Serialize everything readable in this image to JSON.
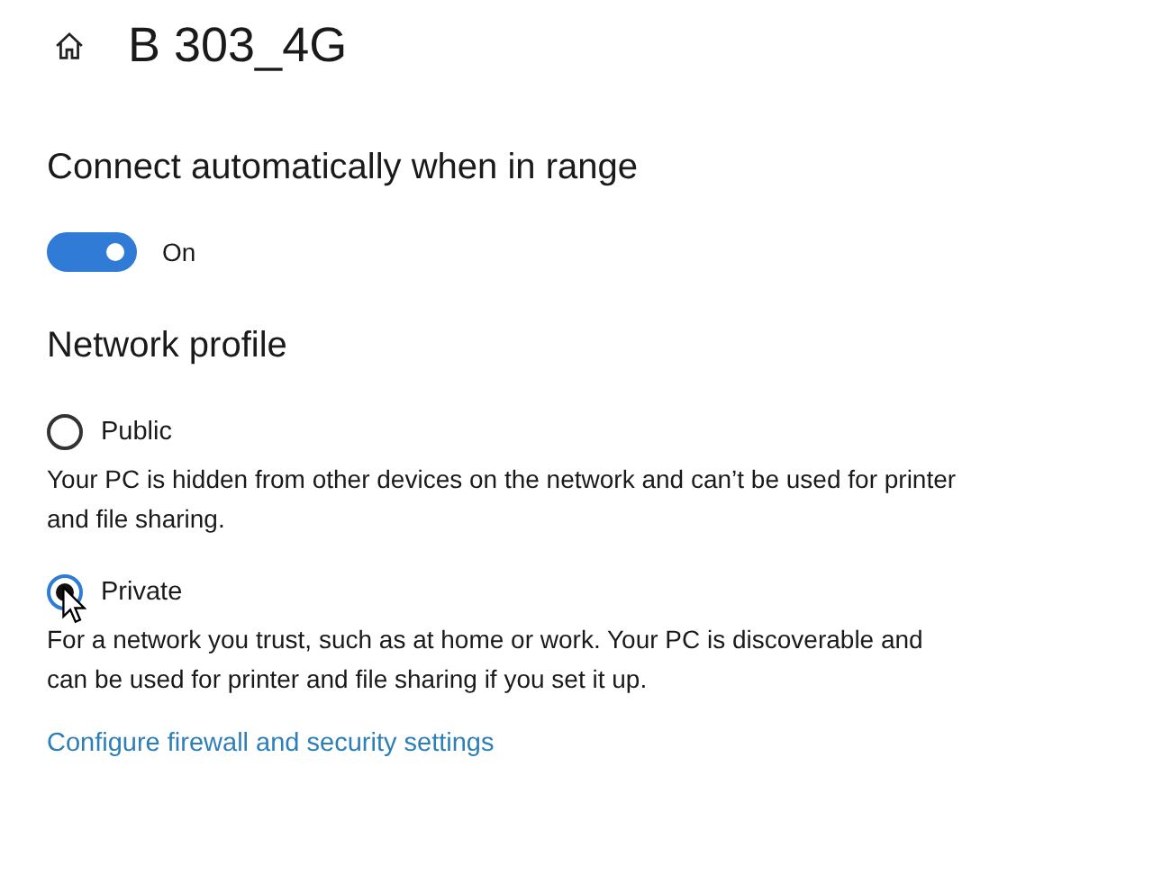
{
  "header": {
    "title": "B 303_4G"
  },
  "auto_connect": {
    "heading": "Connect automatically when in range",
    "toggle": {
      "on": true,
      "label": "On"
    }
  },
  "network_profile": {
    "heading": "Network profile",
    "options": [
      {
        "label": "Public",
        "selected": false,
        "description": "Your PC is hidden from other devices on the network and can’t be used for printer and file sharing."
      },
      {
        "label": "Private",
        "selected": true,
        "description": "For a network you trust, such as at home or work. Your PC is discoverable and can be used for printer and file sharing if you set it up."
      }
    ]
  },
  "link": "Configure firewall and security settings"
}
